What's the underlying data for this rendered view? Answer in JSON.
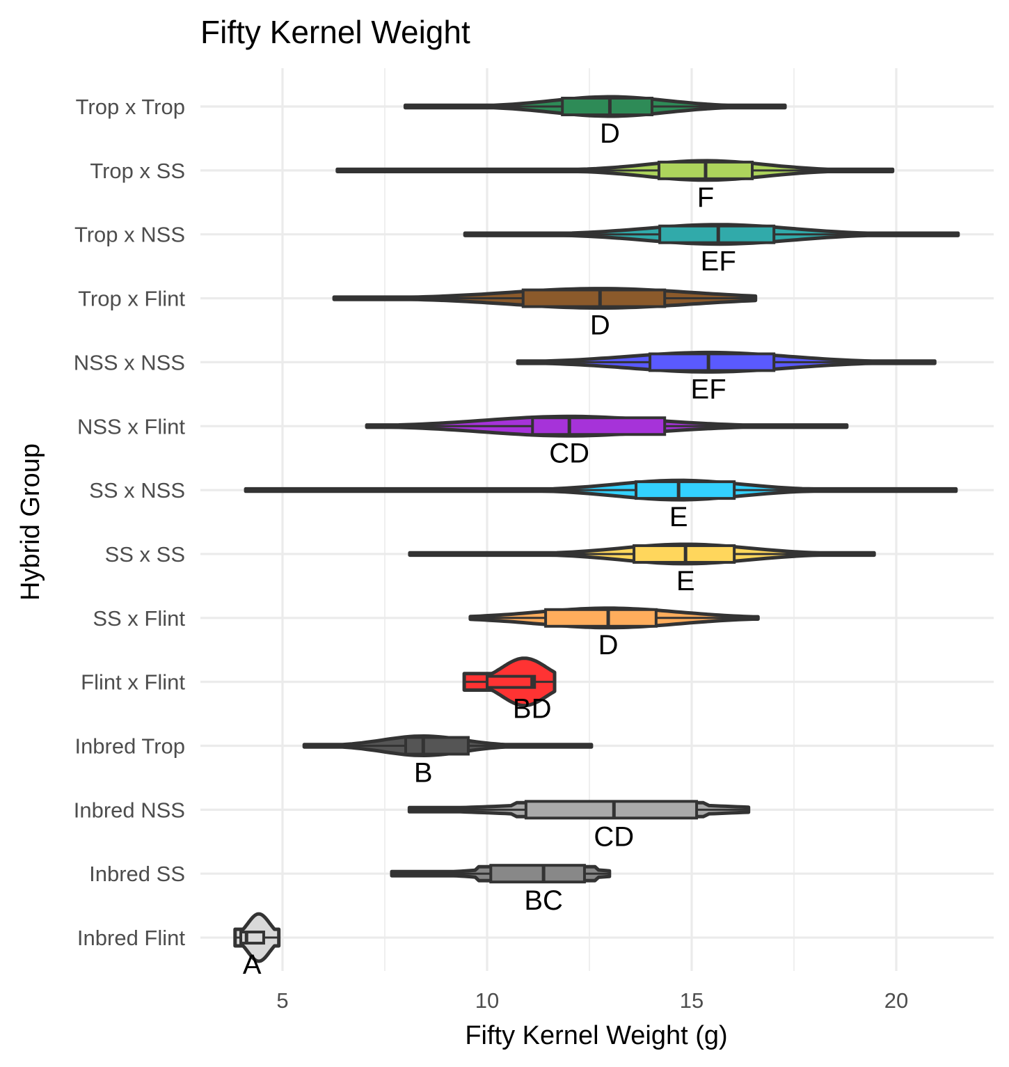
{
  "chart_data": {
    "type": "violin",
    "orientation": "horizontal",
    "title": "Fifty Kernel Weight",
    "xlabel": "Fifty Kernel Weight (g)",
    "ylabel": "Hybrid Group",
    "xlim": [
      3.0,
      22.3
    ],
    "x_ticks": [
      5,
      10,
      15,
      20
    ],
    "x_minor_ticks": [
      7.5,
      12.5,
      17.5
    ],
    "grid": true,
    "legend": "none",
    "outline_color": "#333333",
    "categories": [
      "Trop x Trop",
      "Trop x SS",
      "Trop x NSS",
      "Trop x Flint",
      "NSS x NSS",
      "NSS x Flint",
      "SS x NSS",
      "SS x SS",
      "SS x Flint",
      "Flint x Flint",
      "Inbred Trop",
      "Inbred NSS",
      "Inbred SS",
      "Inbred Flint"
    ],
    "groups": [
      {
        "name": "Trop x Trop",
        "color": "#2e8b57",
        "letter": "D",
        "min": 8.0,
        "q1": 11.84,
        "median": 13.0,
        "q3": 14.03,
        "max": 17.28,
        "shape": "spindle"
      },
      {
        "name": "Trop x SS",
        "color": "#add45c",
        "letter": "F",
        "min": 6.34,
        "q1": 14.2,
        "median": 15.34,
        "q3": 16.48,
        "max": 19.91,
        "shape": "spindle"
      },
      {
        "name": "Trop x NSS",
        "color": "#31aaaa",
        "letter": "EF",
        "min": 9.46,
        "q1": 14.22,
        "median": 15.65,
        "q3": 17.01,
        "max": 21.51,
        "shape": "spindle"
      },
      {
        "name": "Trop x Flint",
        "color": "#8b5a2b",
        "letter": "D",
        "min": 6.26,
        "q1": 10.88,
        "median": 12.76,
        "q3": 14.34,
        "max": 16.56,
        "shape": "spindle"
      },
      {
        "name": "NSS x NSS",
        "color": "#5a5aff",
        "letter": "EF",
        "min": 10.75,
        "q1": 13.98,
        "median": 15.41,
        "q3": 17.01,
        "max": 20.94,
        "shape": "spindle"
      },
      {
        "name": "NSS x Flint",
        "color": "#a633d9",
        "letter": "CD",
        "min": 7.06,
        "q1": 11.11,
        "median": 12.01,
        "q3": 14.34,
        "max": 18.79,
        "shape": "spindle"
      },
      {
        "name": "SS x NSS",
        "color": "#33d1ff",
        "letter": "E",
        "min": 4.1,
        "q1": 13.64,
        "median": 14.68,
        "q3": 16.04,
        "max": 21.46,
        "shape": "spindle"
      },
      {
        "name": "SS x SS",
        "color": "#ffd65c",
        "letter": "E",
        "min": 8.11,
        "q1": 13.59,
        "median": 14.85,
        "q3": 16.04,
        "max": 19.46,
        "shape": "spindle"
      },
      {
        "name": "SS x Flint",
        "color": "#ffad5c",
        "letter": "D",
        "min": 9.59,
        "q1": 11.43,
        "median": 12.96,
        "q3": 14.13,
        "max": 16.62,
        "shape": "spindle"
      },
      {
        "name": "Flint x Flint",
        "color": "#ff3333",
        "letter": "BD",
        "min": 9.44,
        "q1": 10.0,
        "median": 11.1,
        "q3": 11.16,
        "max": 11.65,
        "shape": "wide"
      },
      {
        "name": "Inbred Trop",
        "color": "#555555",
        "letter": "B",
        "min": 5.53,
        "q1": 8.01,
        "median": 8.44,
        "q3": 9.54,
        "max": 12.55,
        "shape": "spindle"
      },
      {
        "name": "Inbred NSS",
        "color": "#aaaaaa",
        "letter": "CD",
        "min": 8.1,
        "q1": 10.95,
        "median": 13.1,
        "q3": 15.12,
        "max": 16.39,
        "shape": "flat"
      },
      {
        "name": "Inbred SS",
        "color": "#888888",
        "letter": "BC",
        "min": 7.67,
        "q1": 10.09,
        "median": 11.38,
        "q3": 12.38,
        "max": 12.99,
        "shape": "flat"
      },
      {
        "name": "Inbred Flint",
        "color": "#d9d9d9",
        "letter": "A",
        "min": 3.84,
        "q1": 3.98,
        "median": 4.12,
        "q3": 4.54,
        "max": 4.91,
        "shape": "wide"
      }
    ]
  }
}
